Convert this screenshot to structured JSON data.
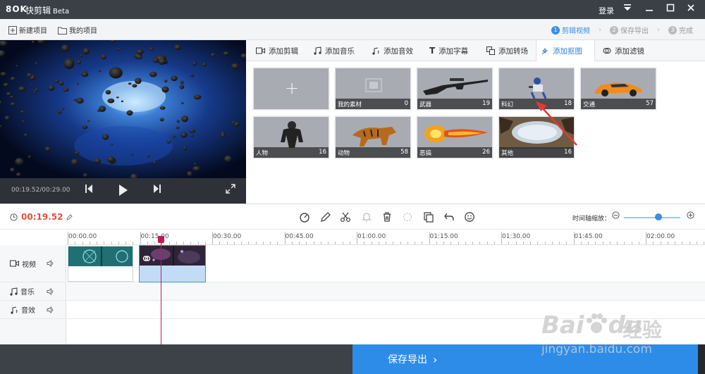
{
  "window": {
    "logo": "8OK",
    "app_name": "快剪辑",
    "beta": "Beta",
    "login": "登录"
  },
  "toolbar": {
    "new_project": "新建项目",
    "my_projects": "我的项目",
    "steps": [
      {
        "num": "1",
        "label": "剪辑视频",
        "active": true
      },
      {
        "num": "2",
        "label": "保存导出",
        "active": false
      },
      {
        "num": "3",
        "label": "完成",
        "active": false
      }
    ]
  },
  "player": {
    "time": "00:19.52/00:29.00"
  },
  "tabs": [
    {
      "label": "添加剪辑",
      "icon": "video-camera-icon",
      "active": false
    },
    {
      "label": "添加音乐",
      "icon": "music-note-icon",
      "active": false
    },
    {
      "label": "添加音效",
      "icon": "sound-effect-icon",
      "active": false
    },
    {
      "label": "添加字幕",
      "icon": "text-icon",
      "active": false
    },
    {
      "label": "添加转场",
      "icon": "transition-icon",
      "active": false
    },
    {
      "label": "添加抠图",
      "icon": "cutout-icon",
      "active": true
    },
    {
      "label": "添加滤镜",
      "icon": "filter-icon",
      "active": false
    }
  ],
  "assets": [
    {
      "name": "",
      "count": "",
      "type": "add"
    },
    {
      "name": "我的素材",
      "count": "0"
    },
    {
      "name": "武器",
      "count": "19"
    },
    {
      "name": "科幻",
      "count": "18"
    },
    {
      "name": "交通",
      "count": "57"
    },
    {
      "name": "人物",
      "count": "16"
    },
    {
      "name": "动物",
      "count": "58"
    },
    {
      "name": "恶搞",
      "count": "26"
    },
    {
      "name": "其他",
      "count": "16"
    }
  ],
  "timeline": {
    "current_time": "00:19.52",
    "zoom_label": "时间轴缩放：",
    "zoom_level": 0.6,
    "ruler": [
      "00:00.00",
      "00:15.00",
      "00:30.00",
      "00:45.00",
      "01:00.00",
      "01:15.00",
      "01:30.00",
      "01:45.00",
      "02:00.00"
    ],
    "tracks": [
      {
        "label": "视频",
        "icon": "video-icon"
      },
      {
        "label": "音乐",
        "icon": "music-icon"
      },
      {
        "label": "音效",
        "icon": "sound-effect-icon"
      }
    ]
  },
  "footer": {
    "save_label": "保存导出"
  },
  "watermark": {
    "brand": "Bai",
    "brand2": "du",
    "cn": "经验",
    "url": "jingyan.baidu.com"
  },
  "colors": {
    "accent": "#2d8ce8",
    "time_red": "#e0533b",
    "playhead": "#c2185b",
    "titlebar": "#3b4047"
  }
}
